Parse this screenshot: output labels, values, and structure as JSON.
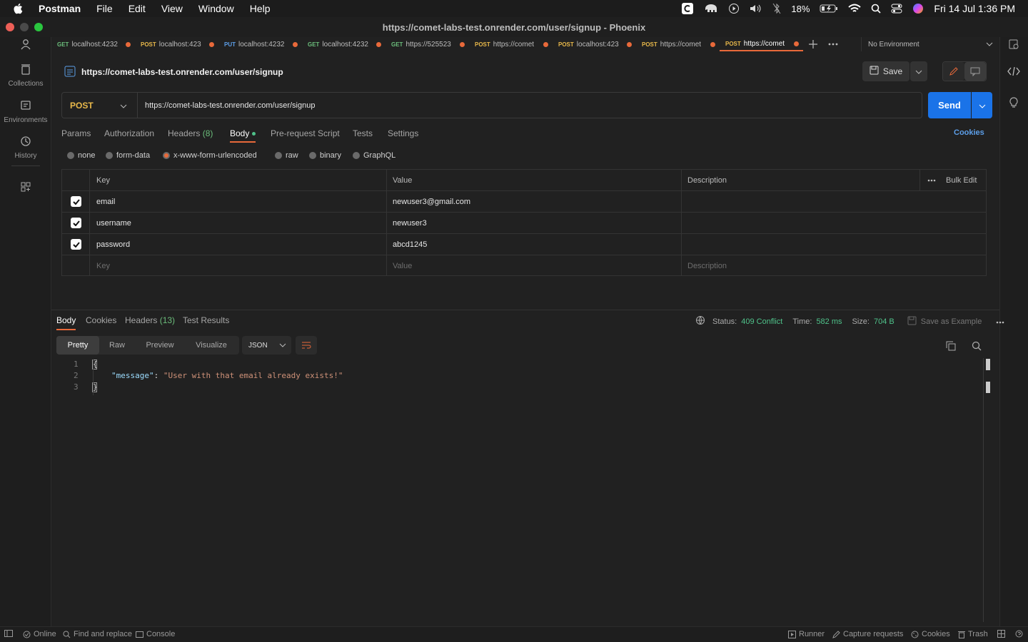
{
  "menubar": {
    "app": "Postman",
    "menus": [
      "File",
      "Edit",
      "View",
      "Window",
      "Help"
    ],
    "battery": "18%",
    "datetime": "Fri 14 Jul  1:36 PM"
  },
  "window": {
    "title": "https://comet-labs-test.onrender.com/user/signup - Phoenix"
  },
  "rail": {
    "items": [
      {
        "label": "Collections",
        "icon": "trash-can-icon"
      },
      {
        "label": "Environments",
        "icon": "environment-icon"
      },
      {
        "label": "History",
        "icon": "history-icon"
      }
    ]
  },
  "tabs": [
    {
      "method": "GET",
      "url": "localhost:4232"
    },
    {
      "method": "POST",
      "url": "localhost:423"
    },
    {
      "method": "PUT",
      "url": "localhost:4232"
    },
    {
      "method": "GET",
      "url": "localhost:4232"
    },
    {
      "method": "GET",
      "url": "https://525523"
    },
    {
      "method": "POST",
      "url": "https://comet"
    },
    {
      "method": "POST",
      "url": "localhost:423"
    },
    {
      "method": "POST",
      "url": "https://comet"
    },
    {
      "method": "POST",
      "url": "https://comet"
    }
  ],
  "environment": "No Environment",
  "request": {
    "name": "https://comet-labs-test.onrender.com/user/signup",
    "save_label": "Save",
    "method": "POST",
    "url": "https://comet-labs-test.onrender.com/user/signup",
    "send_label": "Send",
    "cookies_label": "Cookies",
    "tabs": {
      "params": "Params",
      "authorization": "Authorization",
      "headers": "Headers",
      "headers_count": "(8)",
      "body": "Body",
      "prerequest": "Pre-request Script",
      "tests": "Tests",
      "settings": "Settings"
    },
    "body_types": [
      "none",
      "form-data",
      "x-www-form-urlencoded",
      "raw",
      "binary",
      "GraphQL"
    ],
    "table": {
      "headers": {
        "key": "Key",
        "value": "Value",
        "description": "Description",
        "bulk_edit": "Bulk Edit"
      },
      "rows": [
        {
          "key": "email",
          "value": "newuser3@gmail.com"
        },
        {
          "key": "username",
          "value": "newuser3"
        },
        {
          "key": "password",
          "value": "abcd1245"
        }
      ],
      "placeholders": {
        "key": "Key",
        "value": "Value",
        "description": "Description"
      }
    }
  },
  "response": {
    "tabs": {
      "body": "Body",
      "cookies": "Cookies",
      "headers": "Headers",
      "headers_count": "(13)",
      "tests": "Test Results"
    },
    "status_label": "Status:",
    "status_value": "409 Conflict",
    "time_label": "Time:",
    "time_value": "582 ms",
    "size_label": "Size:",
    "size_value": "704 B",
    "save_example": "Save as Example",
    "views": [
      "Pretty",
      "Raw",
      "Preview",
      "Visualize"
    ],
    "format": "JSON",
    "code_lines": [
      {
        "num": "1",
        "text": "{"
      },
      {
        "num": "2",
        "key": "\"message\"",
        "sep": ": ",
        "value": "\"User with that email already exists!\""
      },
      {
        "num": "3",
        "text": "}"
      }
    ]
  },
  "statusbar": {
    "online": "Online",
    "find_replace": "Find and replace",
    "console": "Console",
    "runner": "Runner",
    "capture": "Capture requests",
    "cookies": "Cookies",
    "trash": "Trash"
  },
  "colors": {
    "accent": "#e8693a",
    "send": "#1a73e8",
    "status_ok": "#4fc28a"
  }
}
